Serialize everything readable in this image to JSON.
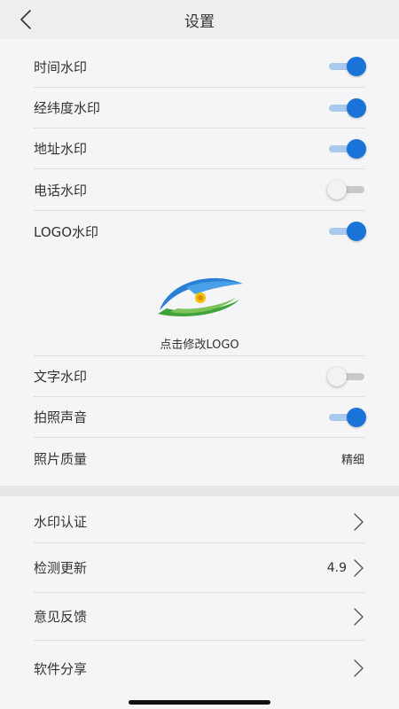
{
  "header": {
    "title": "设置"
  },
  "watermarks": [
    {
      "label": "时间水印",
      "on": true
    },
    {
      "label": "经纬度水印",
      "on": true
    },
    {
      "label": "地址水印",
      "on": true
    },
    {
      "label": "电话水印",
      "on": false
    },
    {
      "label": "LOGO水印",
      "on": true
    }
  ],
  "logo": {
    "caption": "点击修改LOGO"
  },
  "options": [
    {
      "label": "文字水印",
      "on": false
    },
    {
      "label": "拍照声音",
      "on": true
    }
  ],
  "photo_quality": {
    "label": "照片质量",
    "value": "精细"
  },
  "menu": [
    {
      "label": "水印认证",
      "value": ""
    },
    {
      "label": "检测更新",
      "value": "4.9"
    },
    {
      "label": "意见反馈",
      "value": ""
    },
    {
      "label": "软件分享",
      "value": ""
    }
  ],
  "colors": {
    "accent": "#1a73d9",
    "track_on": "#a9c9ee",
    "background": "#f5f4f6"
  }
}
